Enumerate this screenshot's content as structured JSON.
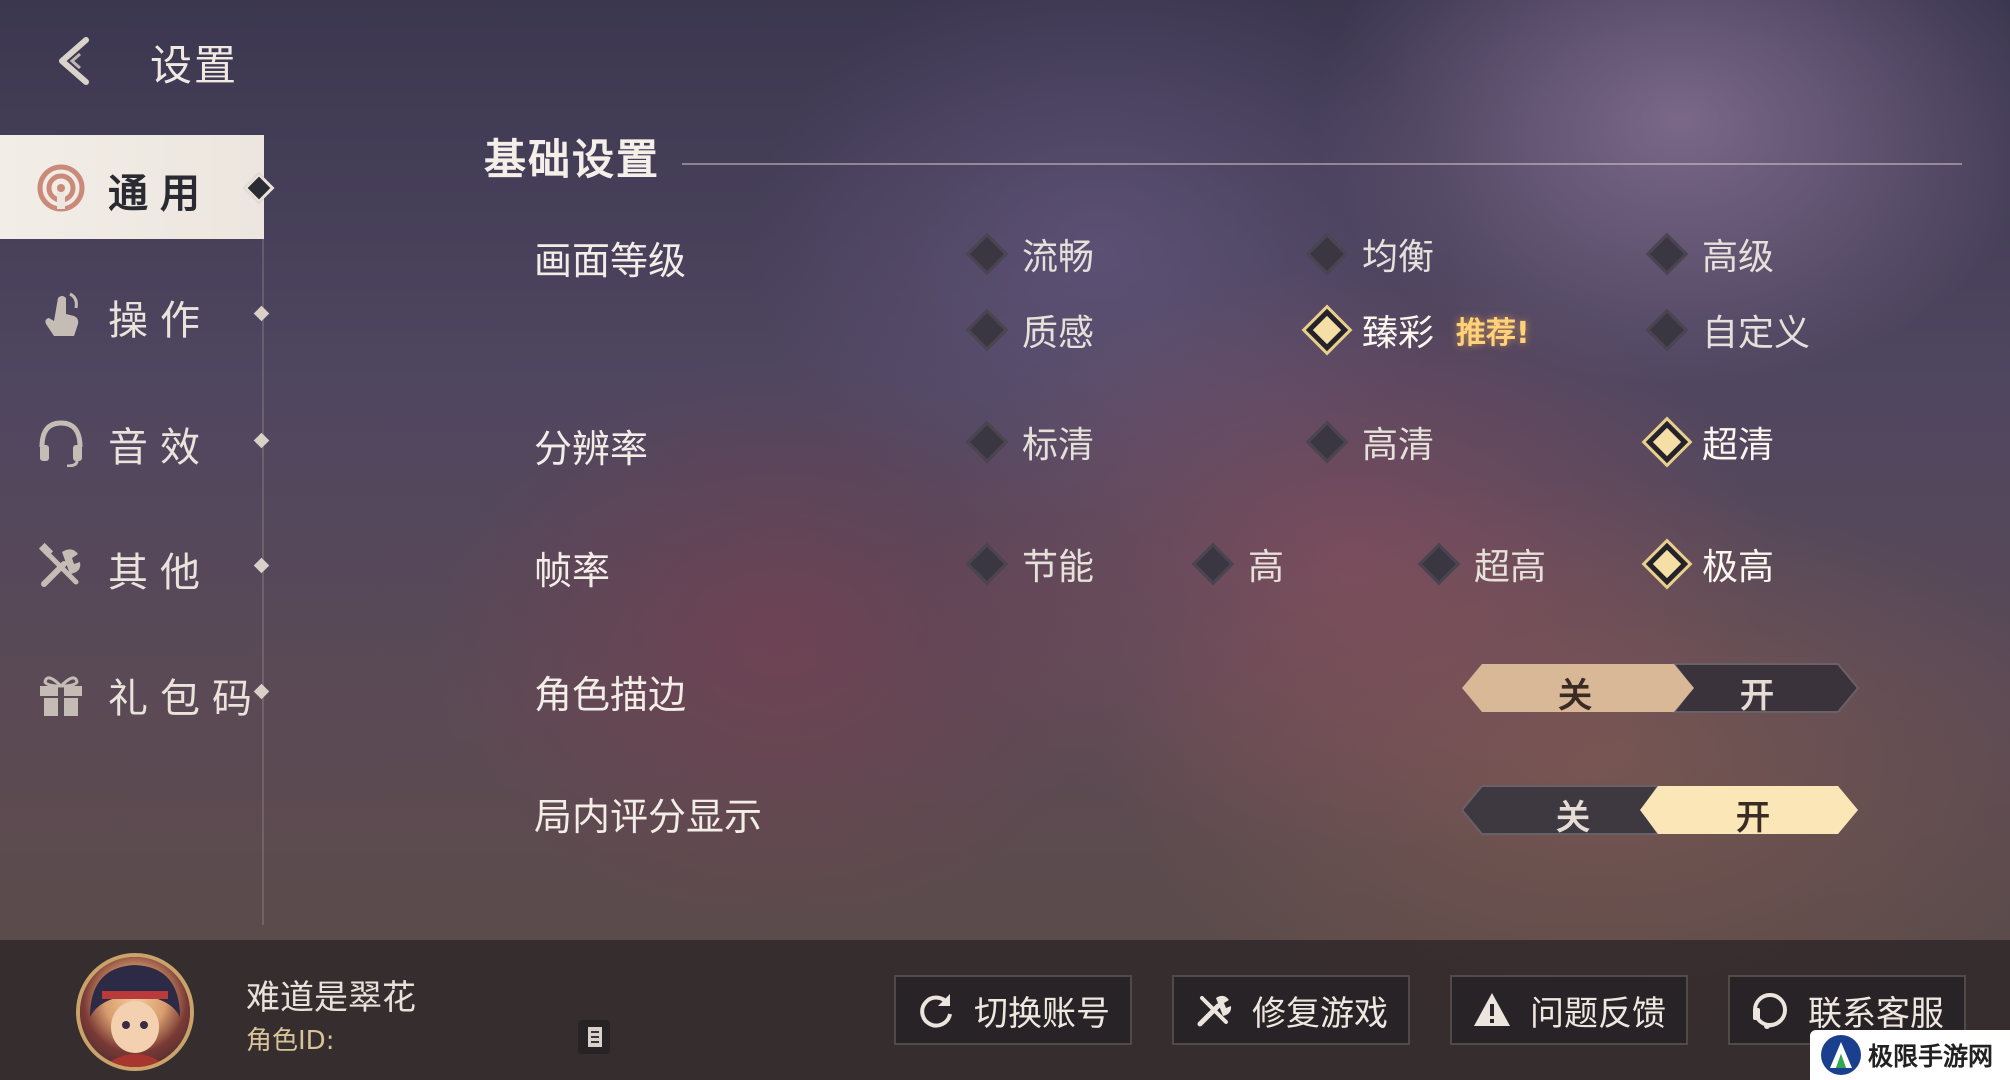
{
  "header": {
    "title": "设置"
  },
  "sidebar": {
    "items": [
      {
        "label": "通用",
        "icon": "general-icon",
        "active": true
      },
      {
        "label": "操作",
        "icon": "touch-hand-icon",
        "active": false
      },
      {
        "label": "音效",
        "icon": "headphones-icon",
        "active": false
      },
      {
        "label": "其他",
        "icon": "tools-icon",
        "active": false
      },
      {
        "label": "礼包码",
        "icon": "gift-icon",
        "active": false
      }
    ]
  },
  "section": {
    "title": "基础设置"
  },
  "settings": {
    "graphics": {
      "label": "画面等级",
      "options": [
        "流畅",
        "均衡",
        "高级",
        "质感",
        "臻彩",
        "自定义"
      ],
      "selected": "臻彩",
      "badge": "推荐!"
    },
    "resolution": {
      "label": "分辨率",
      "options": [
        "标清",
        "高清",
        "超清"
      ],
      "selected": "超清"
    },
    "framerate": {
      "label": "帧率",
      "options": [
        "节能",
        "高",
        "超高",
        "极高"
      ],
      "selected": "极高"
    },
    "outline": {
      "label": "角色描边",
      "off": "关",
      "on": "开",
      "value": "关"
    },
    "score_display": {
      "label": "局内评分显示",
      "off": "关",
      "on": "开",
      "value": "开"
    }
  },
  "profile": {
    "name": "难道是翠花",
    "role_id_label": "角色ID:"
  },
  "actions": [
    {
      "label": "切换账号",
      "icon": "refresh-icon"
    },
    {
      "label": "修复游戏",
      "icon": "repair-tools-icon"
    },
    {
      "label": "问题反馈",
      "icon": "warning-icon"
    },
    {
      "label": "联系客服",
      "icon": "headset-icon"
    }
  ],
  "watermark": {
    "text": "极限手游网"
  },
  "colors": {
    "accent_selected": "#f6dfa6",
    "toggle_off_active": "#d8b896",
    "toggle_on_active": "#fbe6b8",
    "badge": "#ffd27a"
  }
}
